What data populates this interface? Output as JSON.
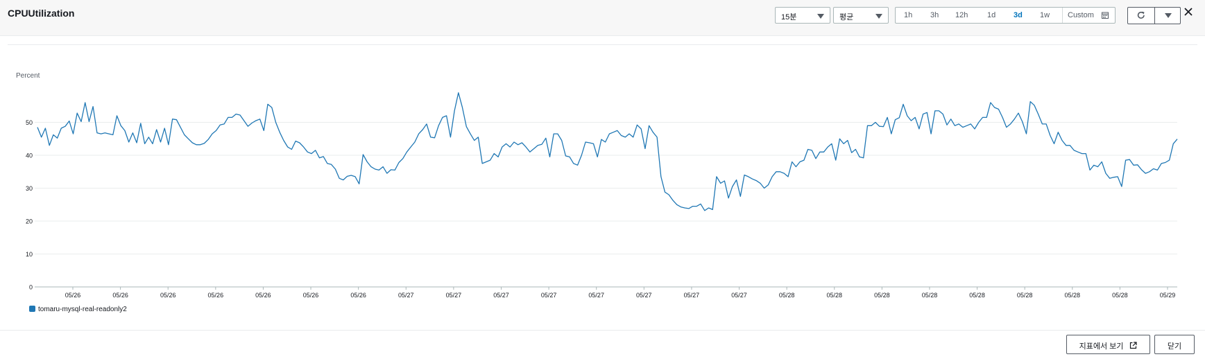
{
  "header": {
    "title": "CPUUtilization",
    "period_select": "15분",
    "stat_select": "평균",
    "time_ranges": [
      "1h",
      "3h",
      "12h",
      "1d",
      "3d",
      "1w"
    ],
    "active_range": "3d",
    "custom_label": "Custom"
  },
  "footer": {
    "view_in_metrics_label": "지표에서 보기",
    "close_label": "닫기"
  },
  "colors": {
    "series": "#1f77b4",
    "accent": "#0073bb"
  },
  "icons": [
    "refresh-icon",
    "caret-down-icon",
    "close-icon",
    "calendar-icon",
    "external-link-icon"
  ],
  "chart_data": {
    "type": "line",
    "ylabel": "Percent",
    "yticks": [
      0,
      10,
      20,
      30,
      40,
      50
    ],
    "ylim": [
      0,
      60
    ],
    "xticks": [
      "05/26",
      "05/26",
      "05/26",
      "05/26",
      "05/26",
      "05/26",
      "05/26",
      "05/27",
      "05/27",
      "05/27",
      "05/27",
      "05/27",
      "05/27",
      "05/27",
      "05/27",
      "05/28",
      "05/28",
      "05/28",
      "05/28",
      "05/28",
      "05/28",
      "05/28",
      "05/28",
      "05/29"
    ],
    "grid": true,
    "legend_position": "bottom-left",
    "series": [
      {
        "name": "tomaru-mysql-real-readonly2",
        "values": [
          48.5,
          45.5,
          48.2,
          43,
          46.2,
          45.2,
          48.2,
          48.8,
          50.4,
          46.5,
          52.8,
          50.2,
          56,
          50.2,
          54.8,
          46.8,
          46.5,
          46.8,
          46.5,
          46.2,
          52,
          49,
          47.5,
          44,
          46.8,
          43.8,
          49.7,
          43.5,
          45.5,
          43.5,
          47.8,
          44,
          48.2,
          43.2,
          51,
          50.8,
          48.5,
          46.2,
          45,
          43.8,
          43.2,
          43.2,
          43.6,
          44.8,
          46.5,
          47.5,
          49.2,
          49.5,
          51.5,
          51.5,
          52.5,
          52.2,
          50.5,
          48.8,
          49.8,
          50.5,
          51,
          47.5,
          55.5,
          54.5,
          50,
          47,
          44.5,
          42.5,
          41.8,
          44.3,
          43.8,
          42.5,
          41,
          40.5,
          41.5,
          39.2,
          39.6,
          37.5,
          37.2,
          35.8,
          33,
          32.5,
          33.6,
          33.9,
          33.5,
          31.3,
          40.2,
          38,
          36.5,
          35.8,
          35.5,
          36.5,
          34.5,
          35.6,
          35.5,
          37.8,
          39,
          41,
          42.5,
          44,
          46.5,
          47.8,
          49.5,
          45.5,
          45.3,
          49,
          51.5,
          52,
          45.5,
          53.5,
          59,
          54.5,
          48.7,
          46.5,
          44.5,
          45.5,
          37.5,
          38,
          38.5,
          40.5,
          39.5,
          42.5,
          43.5,
          42.5,
          44,
          43.2,
          43.8,
          42.5,
          41,
          42,
          43,
          43.3,
          45.2,
          39.5,
          46.5,
          46.5,
          44.5,
          39.8,
          39.5,
          37.5,
          37,
          40,
          44,
          43.8,
          43.5,
          39.5,
          44.8,
          44,
          46.5,
          47,
          47.5,
          46,
          45.5,
          46.5,
          45.5,
          49.2,
          48,
          42,
          49,
          47,
          45.5,
          33.5,
          28.8,
          28,
          26.3,
          25,
          24.3,
          24,
          23.8,
          24.5,
          24.5,
          25.2,
          23.2,
          24,
          23.5,
          33.5,
          31.5,
          32.2,
          27,
          30.5,
          32.5,
          27.5,
          34,
          33.5,
          32.8,
          32.3,
          31.5,
          30,
          31,
          33.5,
          35,
          35,
          34.5,
          33.5,
          38,
          36.5,
          38,
          38.5,
          41.8,
          41.5,
          39,
          41,
          41,
          42.5,
          43.5,
          38.5,
          45,
          43.5,
          44.5,
          40.8,
          41.8,
          39.5,
          39.2,
          49,
          49,
          50,
          48.8,
          48.7,
          51.5,
          46.5,
          50.8,
          51.4,
          55.5,
          52,
          50.5,
          51.5,
          48,
          52.5,
          53,
          46.5,
          53.5,
          53.5,
          52.5,
          49.2,
          51,
          49,
          49.5,
          48.5,
          49,
          49.5,
          48,
          50,
          51.5,
          51.5,
          56,
          54.5,
          54,
          51.5,
          48.5,
          49.5,
          51,
          52.8,
          50.2,
          46.5,
          56.3,
          55.2,
          52.5,
          49.5,
          49.5,
          46,
          43.5,
          47,
          44.5,
          43,
          43,
          41.5,
          41,
          40.5,
          40.5,
          35.5,
          37,
          36.5,
          38,
          34.5,
          33,
          33.3,
          33.5,
          30.5,
          38.5,
          38.7,
          37,
          37.1,
          35.6,
          34.5,
          35,
          35.9,
          35.5,
          37.5,
          37.8,
          38.5,
          43.5,
          44.9
        ]
      }
    ]
  }
}
